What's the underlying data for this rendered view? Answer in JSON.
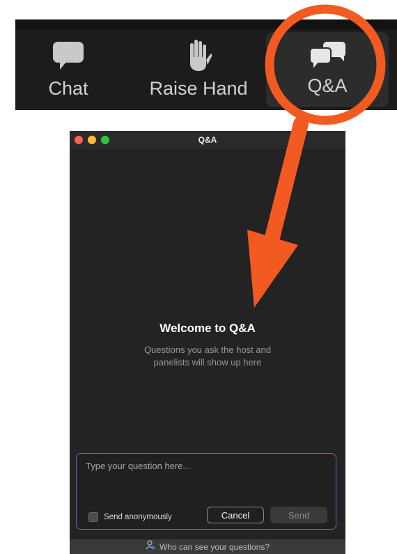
{
  "toolbar": {
    "chat_label": "Chat",
    "raise_hand_label": "Raise Hand",
    "qa_label": "Q&A"
  },
  "window": {
    "title": "Q&A",
    "welcome_title": "Welcome to Q&A",
    "welcome_subtitle": "Questions you ask the host and panelists will show up here"
  },
  "composer": {
    "placeholder": "Type your question here...",
    "anonymous_label": "Send anonymously",
    "anonymous_checked": false,
    "cancel_label": "Cancel",
    "send_label": "Send"
  },
  "footer": {
    "visibility_link": "Who can see your questions?"
  },
  "colors": {
    "annotation": "#f25a22",
    "composer_border": "#4a73c9",
    "toolbar_bg": "#1c1c1c",
    "window_bg": "#232323"
  },
  "icons": {
    "chat": "chat-bubble-icon",
    "raise_hand": "hand-icon",
    "qa": "qa-bubbles-icon",
    "visibility": "person-icon"
  }
}
